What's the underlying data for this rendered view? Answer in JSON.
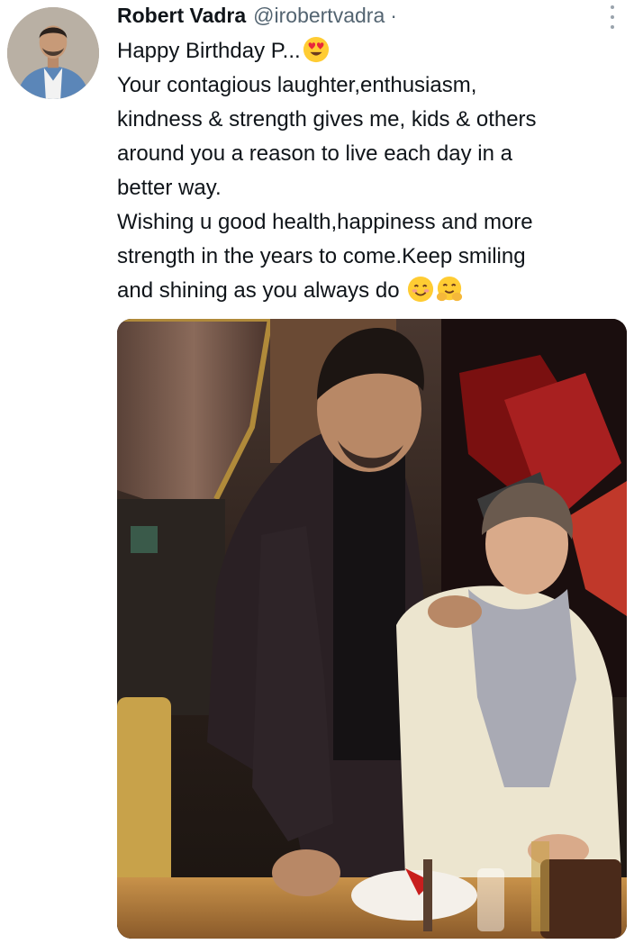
{
  "tweet": {
    "author": {
      "display_name": "Robert Vadra",
      "handle": "@irobertvadra",
      "separator": "·"
    },
    "text_lines": [
      "Happy Birthday P...",
      "Your contagious laughter,enthusiasm,",
      "kindness & strength gives me, kids & others",
      "around you a reason to live each day in a",
      "better way.",
      "Wishing u good health,happiness and more",
      "strength in the years to come.Keep smiling",
      "and shining as you always do"
    ],
    "emojis": {
      "line1": "heart-eyes-emoji",
      "line8": [
        "smiling-face-emoji",
        "hugging-face-emoji"
      ]
    },
    "icons": {
      "more": "more-vertical-icon"
    },
    "media": {
      "kind": "photo",
      "description_icon": "photo-image"
    }
  },
  "colors": {
    "text": "#0f1419",
    "secondary": "#536471"
  }
}
